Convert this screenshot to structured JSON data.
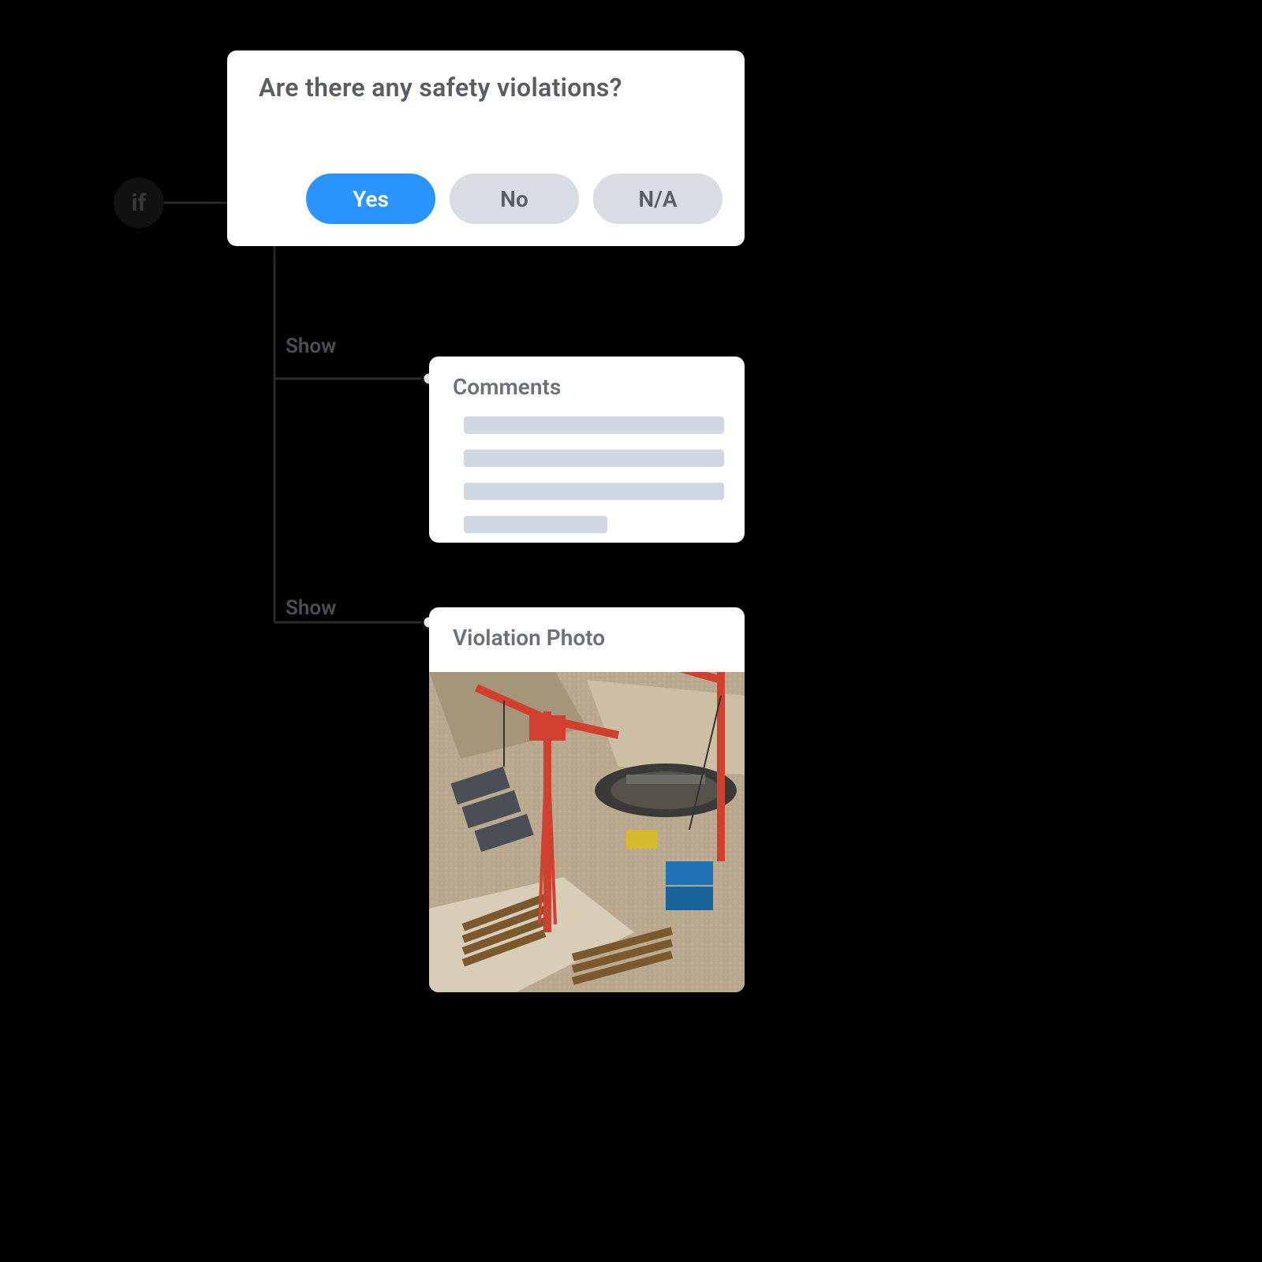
{
  "condition": {
    "badge_label": "if",
    "question": "Are there any safety violations?",
    "options": [
      {
        "label": "Yes",
        "selected": true
      },
      {
        "label": "No",
        "selected": false
      },
      {
        "label": "N/A",
        "selected": false
      }
    ]
  },
  "branches": [
    {
      "action_label": "Show",
      "card_title": "Comments"
    },
    {
      "action_label": "Show",
      "card_title": "Violation Photo"
    }
  ]
}
